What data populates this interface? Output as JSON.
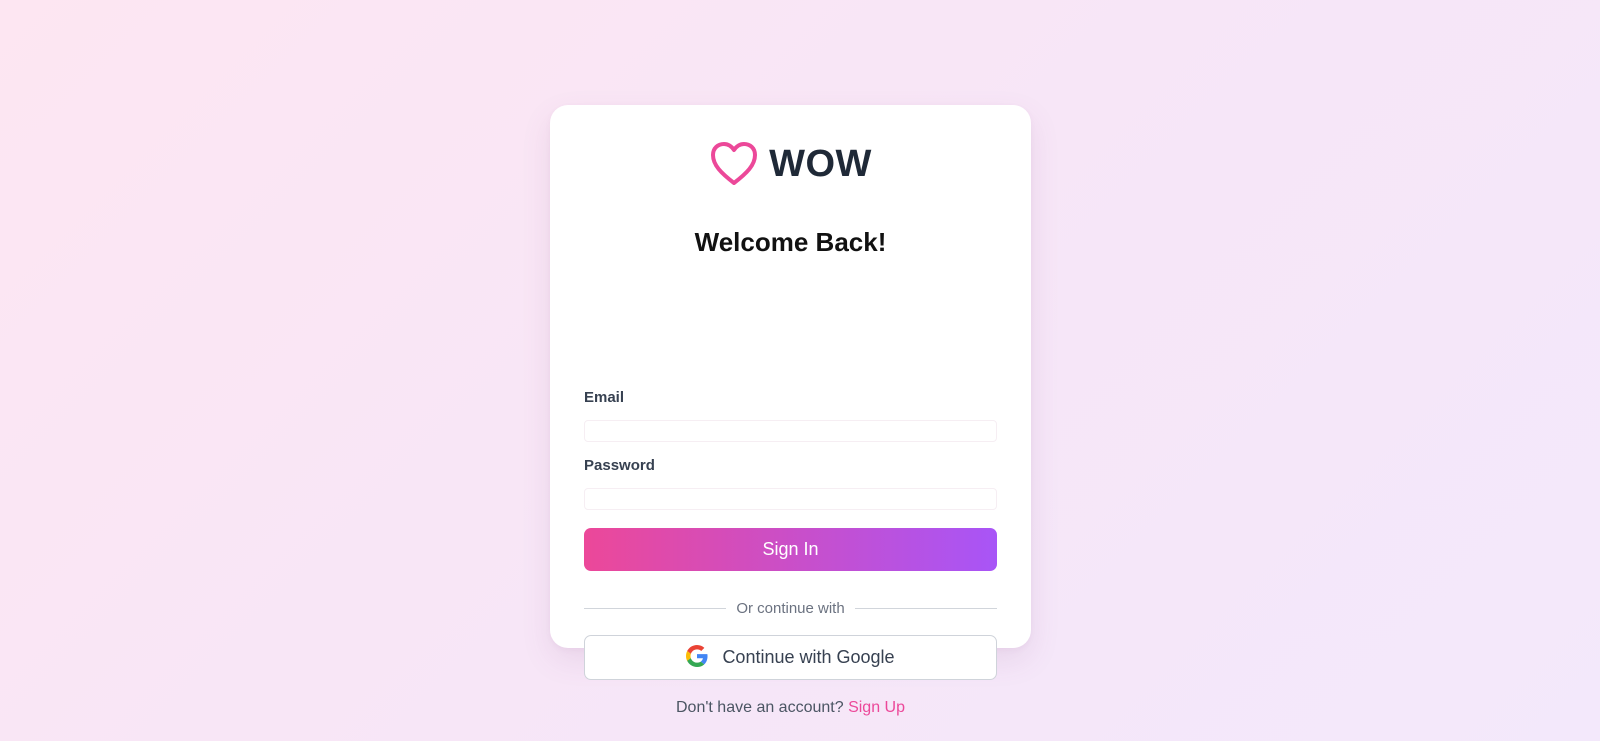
{
  "brand": {
    "name": "WOW",
    "logo_icon": "heart-icon",
    "accent_color": "#ec4899",
    "gradient_end_color": "#a855f7"
  },
  "form": {
    "title": "Welcome Back!",
    "email": {
      "label": "Email",
      "value": "",
      "placeholder": ""
    },
    "password": {
      "label": "Password",
      "value": "",
      "placeholder": ""
    },
    "submit_label": "Sign In"
  },
  "divider": {
    "text": "Or continue with"
  },
  "google": {
    "label": "Continue with Google",
    "icon": "google-icon"
  },
  "footer": {
    "prompt": "Don't have an account?",
    "link_label": "Sign Up"
  }
}
